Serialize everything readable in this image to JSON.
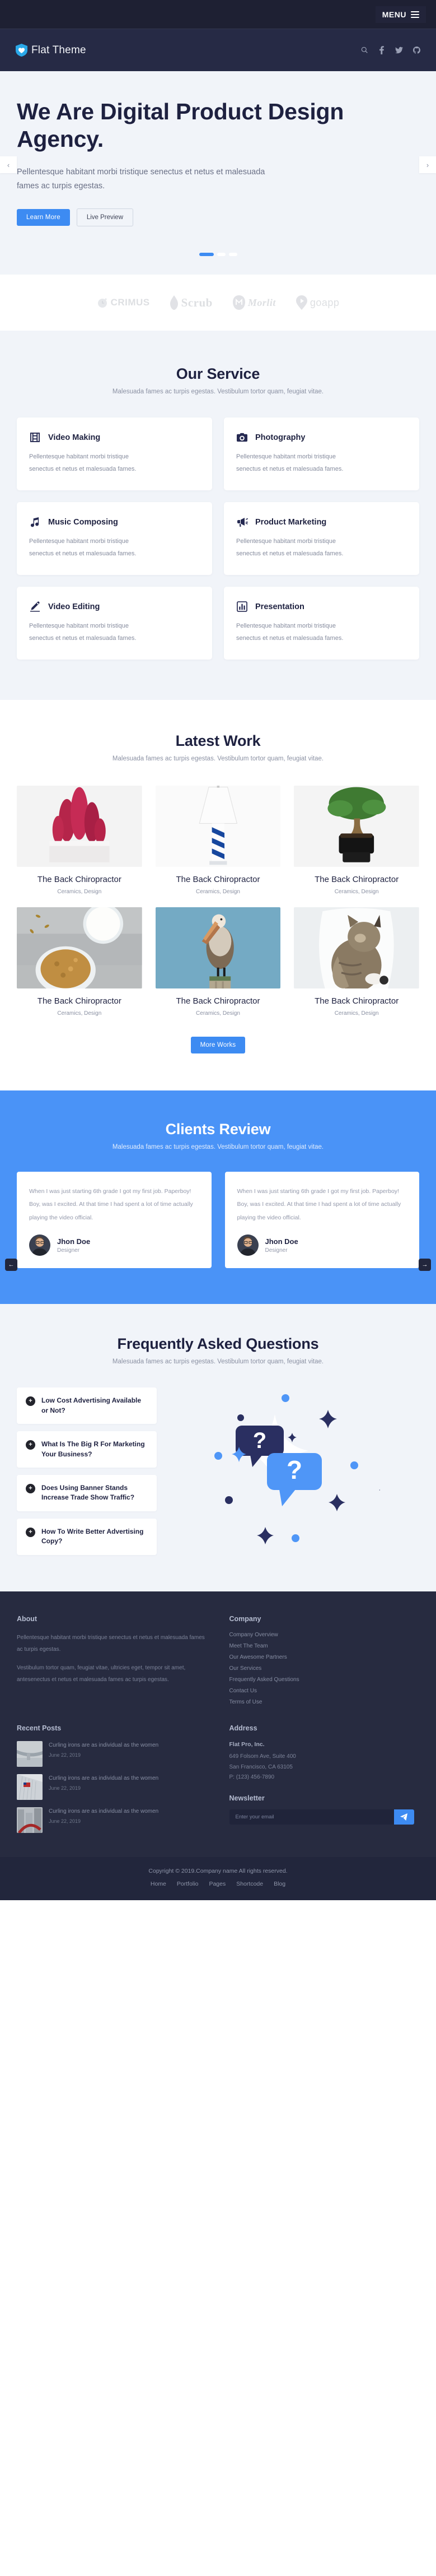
{
  "topbar": {
    "menu_label": "MENU"
  },
  "header": {
    "brand": "Flat Theme",
    "icons": [
      "search-icon",
      "facebook-icon",
      "twitter-icon",
      "github-icon"
    ]
  },
  "hero": {
    "title": "We Are Digital Product Design Agency.",
    "subtitle": "Pellentesque habitant morbi tristique senectus et netus et malesuada fames ac turpis egestas.",
    "primary_button": "Learn More",
    "secondary_button": "Live Preview",
    "prev_arrow": "‹",
    "next_arrow": "›",
    "slides": 3,
    "active_slide": 1
  },
  "clients": [
    {
      "name": "CRIMUS",
      "style": "lg-crimus"
    },
    {
      "name": "Scrub",
      "style": "lg-scrub"
    },
    {
      "name": "Morlit",
      "style": "lg-morlit"
    },
    {
      "name": "goapp",
      "style": "lg-goapp"
    }
  ],
  "services": {
    "title": "Our Service",
    "subtitle": "Malesuada fames ac turpis egestas. Vestibulum tortor quam, feugiat vitae.",
    "items": [
      {
        "icon": "film-icon",
        "name": "Video Making",
        "desc": "Pellentesque habitant morbi tristique senectus et netus et malesuada fames."
      },
      {
        "icon": "camera-icon",
        "name": "Photography",
        "desc": "Pellentesque habitant morbi tristique senectus et netus et malesuada fames."
      },
      {
        "icon": "music-note-icon",
        "name": "Music Composing",
        "desc": "Pellentesque habitant morbi tristique senectus et netus et malesuada fames."
      },
      {
        "icon": "megaphone-icon",
        "name": "Product Marketing",
        "desc": "Pellentesque habitant morbi tristique senectus et netus et malesuada fames."
      },
      {
        "icon": "pen-icon",
        "name": "Video Editing",
        "desc": "Pellentesque habitant morbi tristique senectus et netus et malesuada fames."
      },
      {
        "icon": "bar-chart-icon",
        "name": "Presentation",
        "desc": "Pellentesque habitant morbi tristique senectus et netus et malesuada fames."
      }
    ]
  },
  "work": {
    "title": "Latest Work",
    "subtitle": "Malesuada fames ac turpis egestas. Vestibulum tortor quam, feugiat vitae.",
    "more_button": "More Works",
    "items": [
      {
        "title": "The Back Chiropractor",
        "category": "Ceramics, Design",
        "image": "pink-cactus-in-white-pot"
      },
      {
        "title": "The Back Chiropractor",
        "category": "Ceramics, Design",
        "image": "white-lamp-with-blue-chevron-base"
      },
      {
        "title": "The Back Chiropractor",
        "category": "Ceramics, Design",
        "image": "bonsai-tree-in-black-pot"
      },
      {
        "title": "The Back Chiropractor",
        "category": "Ceramics, Design",
        "image": "cereal-bowl-and-milk"
      },
      {
        "title": "The Back Chiropractor",
        "category": "Ceramics, Design",
        "image": "pelican-on-post-blue-sky"
      },
      {
        "title": "The Back Chiropractor",
        "category": "Ceramics, Design",
        "image": "tabby-cat-on-white-chair"
      }
    ]
  },
  "reviews": {
    "title": "Clients Review",
    "subtitle": "Malesuada fames ac turpis egestas. Vestibulum tortor quam, feugiat vitae.",
    "prev_arrow": "←",
    "next_arrow": "→",
    "items": [
      {
        "text": "When I was just starting 6th grade I got my first job. Paperboy! Boy, was I excited. At that time I had spent a lot of time actually playing the video official.",
        "name": "Jhon Doe",
        "role": "Designer"
      },
      {
        "text": "When I was just starting 6th grade I got my first job. Paperboy! Boy, was I excited. At that time I had spent a lot of time actually playing the video official.",
        "name": "Jhon Doe",
        "role": "Designer"
      }
    ]
  },
  "faq": {
    "title": "Frequently Asked Questions",
    "subtitle": "Malesuada fames ac turpis egestas. Vestibulum tortor quam, feugiat vitae.",
    "plus": "+",
    "items": [
      {
        "question": "Low Cost Advertising Available or Not?"
      },
      {
        "question": "What Is The Big R For Marketing Your Business?"
      },
      {
        "question": "Does Using Banner Stands Increase Trade Show Traffic?"
      },
      {
        "question": "How To Write Better Advertising Copy?"
      }
    ]
  },
  "footer": {
    "about": {
      "title": "About",
      "p1": "Pellentesque habitant morbi tristique senectus et netus et malesuada fames ac turpis egestas.",
      "p2": "Vestibulum tortor quam, feugiat vitae, ultricies eget, tempor sit amet, antesenectus et netus et malesuada fames ac turpis egestas."
    },
    "company": {
      "title": "Company",
      "links": [
        "Company Overview",
        "Meet The Team",
        "Our Awesome Partners",
        "Our Services",
        "Frequently Asked Questions",
        "Contact Us",
        "Terms of Use"
      ]
    },
    "recent_posts": {
      "title": "Recent Posts",
      "items": [
        {
          "title": "Curling irons are as individual as the women",
          "date": "June 22, 2019",
          "image": "bridge-over-water"
        },
        {
          "title": "Curling irons are as individual as the women",
          "date": "June 22, 2019",
          "image": "american-flag-architecture"
        },
        {
          "title": "Curling irons are as individual as the women",
          "date": "June 22, 2019",
          "image": "red-sculpture-city"
        }
      ]
    },
    "address": {
      "title": "Address",
      "company": "Flat Pro, Inc.",
      "line1": "649 Folsom Ave, Suite 400",
      "line2": "San Francisco, CA 63105",
      "phone": "P: (123) 456-7890"
    },
    "newsletter": {
      "title": "Newsletter",
      "placeholder": "Enter your email",
      "value": "",
      "button_icon": "send-icon"
    }
  },
  "copyright": {
    "text": "Copyright © 2019.Company name All rights reserved.",
    "links": [
      "Home",
      "Portfolio",
      "Pages",
      "Shortcode",
      "Blog"
    ]
  },
  "colors": {
    "accent": "#3d8bf2",
    "accent_light": "#4a93f7",
    "dark": "#272b40",
    "darker": "#22263c",
    "navy": "#1e2140",
    "light_bg": "#f1f4f9"
  }
}
